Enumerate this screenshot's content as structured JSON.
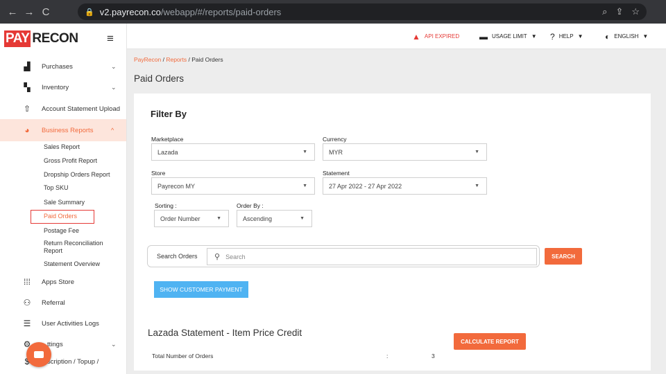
{
  "browser": {
    "url_host": "v2.payrecon.co",
    "url_path": "/webapp/#/reports/paid-orders"
  },
  "logo": {
    "part1": "PAY",
    "part2": "RECON"
  },
  "sidebar": {
    "items": [
      {
        "label": "Purchases",
        "icon": "truck-icon"
      },
      {
        "label": "Inventory",
        "icon": "boxes-icon"
      },
      {
        "label": "Account Statement Upload",
        "icon": "upload-icon"
      },
      {
        "label": "Business Reports",
        "icon": "pie-chart-icon"
      },
      {
        "label": "Apps Store",
        "icon": "grid-icon"
      },
      {
        "label": "Referral",
        "icon": "users-icon"
      },
      {
        "label": "User Activities Logs",
        "icon": "list-icon"
      },
      {
        "label": "ttings",
        "icon": "gear-icon"
      },
      {
        "label": "scription / Topup /",
        "icon": "dollar-icon"
      }
    ],
    "sub_items": [
      "Sales Report",
      "Gross Profit Report",
      "Dropship Orders Report",
      "Top SKU",
      "Sale Summary",
      "Paid Orders",
      "Postage Fee",
      "Return Reconciliation",
      "Report",
      "Statement Overview"
    ]
  },
  "topbar": {
    "api": "API EXPIRED",
    "usage": "USAGE LIMIT",
    "help": "HELP",
    "lang": "ENGLISH"
  },
  "breadcrumb": {
    "c1": "PayRecon",
    "sep": "/",
    "c2": "Reports",
    "c3": "Paid Orders"
  },
  "page_title": "Paid Orders",
  "filter": {
    "title": "Filter By",
    "marketplace_label": "Marketplace",
    "marketplace_value": "Lazada",
    "currency_label": "Currency",
    "currency_value": "MYR",
    "store_label": "Store",
    "store_value": "Payrecon MY",
    "statement_label": "Statement",
    "statement_value": "27 Apr 2022 - 27 Apr 2022",
    "sorting_label": "Sorting :",
    "sorting_value": "Order Number",
    "orderby_label": "Order By :",
    "orderby_value": "Ascending"
  },
  "search": {
    "label": "Search Orders",
    "placeholder": "Search",
    "button": "SEARCH"
  },
  "show_payment_button": "SHOW CUSTOMER PAYMENT",
  "statement": {
    "title": "Lazada Statement - Item Price Credit",
    "calc_button": "CALCULATE REPORT",
    "total_label": "Total Number of Orders",
    "colon": ":",
    "total_value": "3"
  },
  "colors": {
    "accent": "#f26a3c",
    "danger": "#e53935",
    "info": "#4fb3f2"
  }
}
